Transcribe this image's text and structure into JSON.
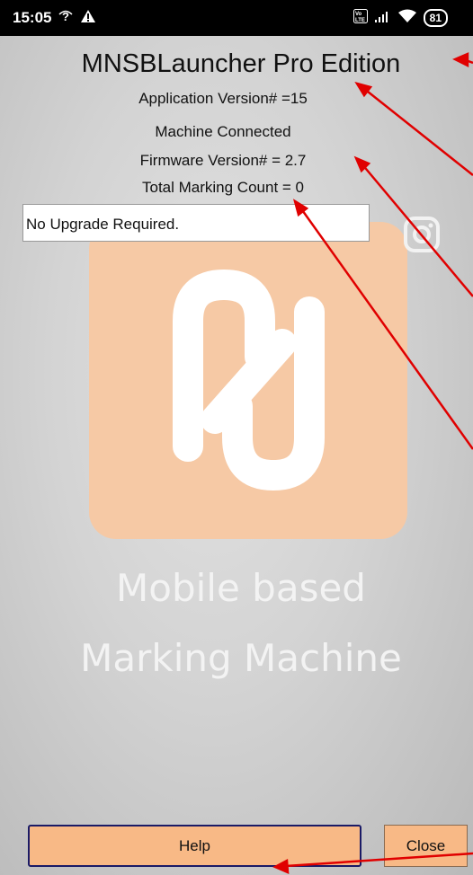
{
  "status_bar": {
    "time": "15:05",
    "left_icons": [
      "wifi-question-icon",
      "warning-icon"
    ],
    "right_icons": [
      "volte-icon",
      "signal-icon",
      "wifi-icon"
    ],
    "battery": "81"
  },
  "header": {
    "title": "MNSBLauncher Pro Edition"
  },
  "info": {
    "app_version": "Application Version# =15",
    "connection": "Machine Connected",
    "firmware_version": "Firmware Version# = 2.7",
    "marking_count": "Total Marking Count = 0"
  },
  "status_message": "No Upgrade Required.",
  "background": {
    "tagline_line1": "Mobile based",
    "tagline_line2": "Marking Machine",
    "tile_color": "#f6c9a5"
  },
  "buttons": {
    "help": "Help",
    "close": "Close"
  },
  "colors": {
    "button_bg": "#f8b986",
    "annotation_arrow": "#e00000"
  }
}
